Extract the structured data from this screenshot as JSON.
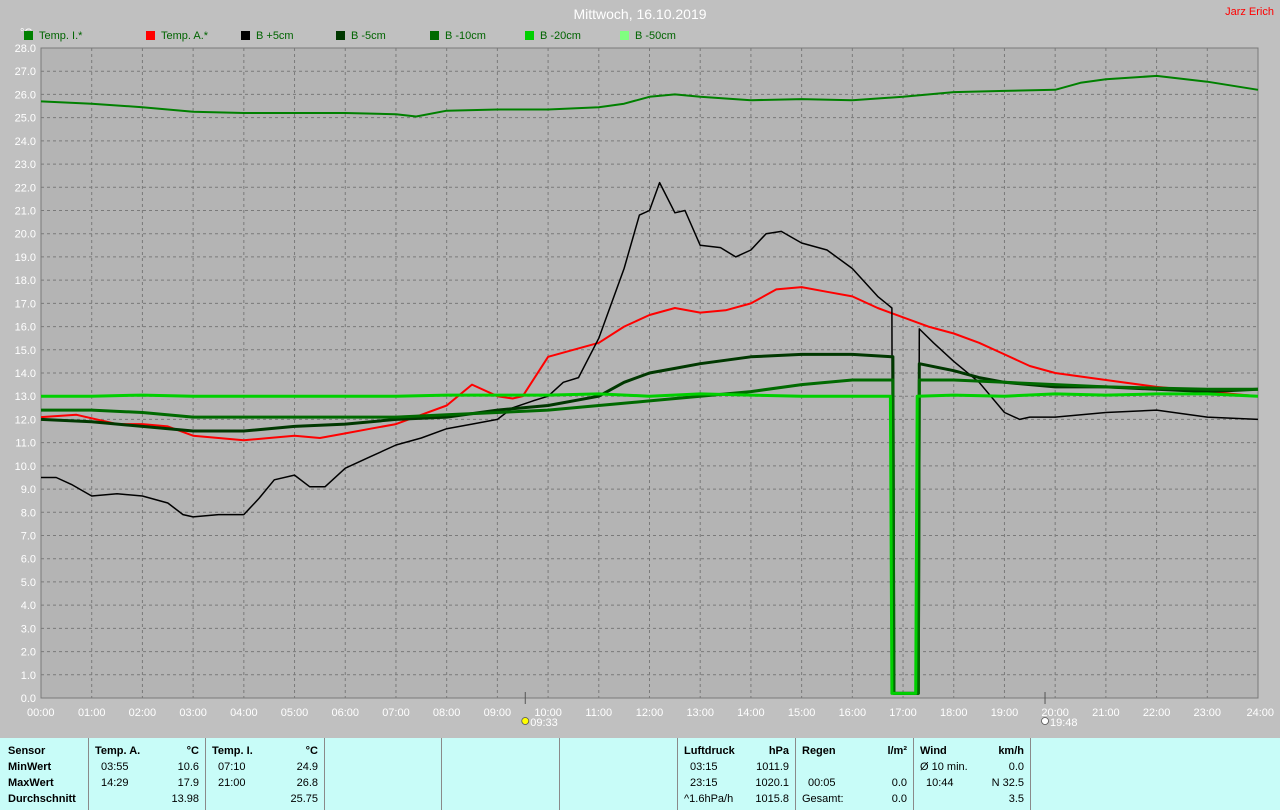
{
  "header": {
    "title": "Mittwoch, 16.10.2019",
    "author": "Jarz Erich"
  },
  "chart_data": {
    "type": "line",
    "ylabel": "°C",
    "ylim": [
      0,
      28
    ],
    "yticks": [
      "0.0",
      "1.0",
      "2.0",
      "3.0",
      "4.0",
      "5.0",
      "6.0",
      "7.0",
      "8.0",
      "9.0",
      "10.0",
      "11.0",
      "12.0",
      "13.0",
      "14.0",
      "15.0",
      "16.0",
      "17.0",
      "18.0",
      "19.0",
      "20.0",
      "21.0",
      "22.0",
      "23.0",
      "24.0",
      "25.0",
      "26.0",
      "27.0",
      "28.0"
    ],
    "xlim": [
      0,
      24
    ],
    "xticks": [
      "00:00",
      "01:00",
      "02:00",
      "03:00",
      "04:00",
      "05:00",
      "06:00",
      "07:00",
      "08:00",
      "09:00",
      "10:00",
      "11:00",
      "12:00",
      "13:00",
      "14:00",
      "15:00",
      "16:00",
      "17:00",
      "18:00",
      "19:00",
      "20:00",
      "21:00",
      "22:00",
      "23:00",
      "24:00"
    ],
    "grid": true,
    "legend_position": "top-left",
    "markers": [
      {
        "x": 9.55,
        "label": "09:33"
      },
      {
        "x": 19.8,
        "label": "19:48"
      }
    ],
    "series": [
      {
        "name": "Temp. I.*",
        "color": "#008000",
        "width": 2,
        "points": [
          [
            0,
            25.7
          ],
          [
            1,
            25.6
          ],
          [
            2,
            25.45
          ],
          [
            3,
            25.25
          ],
          [
            4,
            25.2
          ],
          [
            5,
            25.2
          ],
          [
            6,
            25.2
          ],
          [
            7,
            25.15
          ],
          [
            7.4,
            25.05
          ],
          [
            8,
            25.3
          ],
          [
            9,
            25.35
          ],
          [
            10,
            25.35
          ],
          [
            11,
            25.45
          ],
          [
            11.5,
            25.6
          ],
          [
            12,
            25.9
          ],
          [
            12.5,
            26.0
          ],
          [
            13,
            25.9
          ],
          [
            14,
            25.75
          ],
          [
            15,
            25.8
          ],
          [
            16,
            25.75
          ],
          [
            17,
            25.9
          ],
          [
            18,
            26.1
          ],
          [
            19,
            26.15
          ],
          [
            20,
            26.2
          ],
          [
            20.5,
            26.5
          ],
          [
            21,
            26.65
          ],
          [
            22,
            26.8
          ],
          [
            23,
            26.55
          ],
          [
            24,
            26.2
          ]
        ]
      },
      {
        "name": "Temp. A.*",
        "color": "#ff0000",
        "width": 2,
        "points": [
          [
            0,
            12.1
          ],
          [
            0.7,
            12.2
          ],
          [
            1.5,
            11.8
          ],
          [
            2,
            11.8
          ],
          [
            2.5,
            11.7
          ],
          [
            3,
            11.3
          ],
          [
            3.5,
            11.2
          ],
          [
            4,
            11.1
          ],
          [
            4.5,
            11.2
          ],
          [
            5,
            11.3
          ],
          [
            5.5,
            11.2
          ],
          [
            6,
            11.4
          ],
          [
            6.5,
            11.6
          ],
          [
            7,
            11.8
          ],
          [
            7.5,
            12.2
          ],
          [
            8,
            12.6
          ],
          [
            8.5,
            13.5
          ],
          [
            9,
            13.0
          ],
          [
            9.3,
            12.9
          ],
          [
            9.5,
            13.0
          ],
          [
            10,
            14.7
          ],
          [
            10.5,
            15.0
          ],
          [
            11,
            15.3
          ],
          [
            11.5,
            16.0
          ],
          [
            12,
            16.5
          ],
          [
            12.5,
            16.8
          ],
          [
            13,
            16.6
          ],
          [
            13.5,
            16.7
          ],
          [
            14,
            17.0
          ],
          [
            14.5,
            17.6
          ],
          [
            15,
            17.7
          ],
          [
            15.5,
            17.5
          ],
          [
            16,
            17.3
          ],
          [
            16.5,
            16.8
          ],
          [
            17,
            16.4
          ],
          [
            17.5,
            16.0
          ],
          [
            18,
            15.7
          ],
          [
            18.5,
            15.3
          ],
          [
            19,
            14.8
          ],
          [
            19.5,
            14.3
          ],
          [
            20,
            14.0
          ],
          [
            21,
            13.7
          ],
          [
            22,
            13.4
          ],
          [
            23,
            13.2
          ],
          [
            24,
            13.0
          ]
        ]
      },
      {
        "name": "B +5cm",
        "color": "#000000",
        "width": 1.5,
        "points": [
          [
            0,
            9.5
          ],
          [
            0.3,
            9.5
          ],
          [
            0.6,
            9.2
          ],
          [
            1,
            8.7
          ],
          [
            1.5,
            8.8
          ],
          [
            2,
            8.7
          ],
          [
            2.5,
            8.4
          ],
          [
            2.8,
            7.9
          ],
          [
            3,
            7.8
          ],
          [
            3.5,
            7.9
          ],
          [
            4,
            7.9
          ],
          [
            4.3,
            8.6
          ],
          [
            4.6,
            9.4
          ],
          [
            5,
            9.6
          ],
          [
            5.3,
            9.1
          ],
          [
            5.6,
            9.1
          ],
          [
            6,
            9.9
          ],
          [
            6.5,
            10.4
          ],
          [
            7,
            10.9
          ],
          [
            7.5,
            11.2
          ],
          [
            8,
            11.6
          ],
          [
            8.5,
            11.8
          ],
          [
            9,
            12.0
          ],
          [
            9.3,
            12.5
          ],
          [
            9.7,
            12.8
          ],
          [
            10,
            13.0
          ],
          [
            10.3,
            13.6
          ],
          [
            10.6,
            13.8
          ],
          [
            11,
            15.5
          ],
          [
            11.5,
            18.5
          ],
          [
            11.8,
            20.8
          ],
          [
            12,
            21.0
          ],
          [
            12.2,
            22.2
          ],
          [
            12.5,
            20.9
          ],
          [
            12.7,
            21.0
          ],
          [
            13,
            19.5
          ],
          [
            13.4,
            19.4
          ],
          [
            13.7,
            19.0
          ],
          [
            14,
            19.3
          ],
          [
            14.3,
            20.0
          ],
          [
            14.6,
            20.1
          ],
          [
            15,
            19.6
          ],
          [
            15.5,
            19.3
          ],
          [
            16,
            18.5
          ],
          [
            16.5,
            17.3
          ],
          [
            16.78,
            16.8
          ],
          [
            16.8,
            0.2
          ],
          [
            17.3,
            0.2
          ],
          [
            17.32,
            15.9
          ],
          [
            17.6,
            15.3
          ],
          [
            18,
            14.5
          ],
          [
            18.5,
            13.6
          ],
          [
            19,
            12.3
          ],
          [
            19.3,
            12.0
          ],
          [
            19.5,
            12.1
          ],
          [
            20,
            12.1
          ],
          [
            21,
            12.3
          ],
          [
            22,
            12.4
          ],
          [
            23,
            12.1
          ],
          [
            24,
            12.0
          ]
        ]
      },
      {
        "name": "B -5cm",
        "color": "#003800",
        "width": 3,
        "points": [
          [
            0,
            12.0
          ],
          [
            1,
            11.9
          ],
          [
            2,
            11.7
          ],
          [
            3,
            11.5
          ],
          [
            4,
            11.5
          ],
          [
            5,
            11.7
          ],
          [
            6,
            11.8
          ],
          [
            7,
            12.0
          ],
          [
            8,
            12.1
          ],
          [
            9,
            12.4
          ],
          [
            10,
            12.6
          ],
          [
            11,
            13.0
          ],
          [
            11.5,
            13.6
          ],
          [
            12,
            14.0
          ],
          [
            12.5,
            14.2
          ],
          [
            13,
            14.4
          ],
          [
            14,
            14.7
          ],
          [
            15,
            14.8
          ],
          [
            16,
            14.8
          ],
          [
            16.8,
            14.7
          ],
          [
            16.82,
            0.2
          ],
          [
            17.3,
            0.2
          ],
          [
            17.32,
            14.4
          ],
          [
            18,
            14.1
          ],
          [
            18.5,
            13.8
          ],
          [
            19,
            13.6
          ],
          [
            20,
            13.4
          ],
          [
            21,
            13.4
          ],
          [
            22,
            13.3
          ],
          [
            23,
            13.2
          ],
          [
            24,
            13.3
          ]
        ]
      },
      {
        "name": "B -10cm",
        "color": "#006a00",
        "width": 3,
        "points": [
          [
            0,
            12.4
          ],
          [
            1,
            12.4
          ],
          [
            2,
            12.3
          ],
          [
            3,
            12.1
          ],
          [
            4,
            12.1
          ],
          [
            5,
            12.1
          ],
          [
            6,
            12.1
          ],
          [
            7,
            12.1
          ],
          [
            8,
            12.2
          ],
          [
            9,
            12.3
          ],
          [
            10,
            12.4
          ],
          [
            11,
            12.6
          ],
          [
            12,
            12.8
          ],
          [
            13,
            13.0
          ],
          [
            14,
            13.2
          ],
          [
            15,
            13.5
          ],
          [
            16,
            13.7
          ],
          [
            16.8,
            13.7
          ],
          [
            16.82,
            0.2
          ],
          [
            17.3,
            0.2
          ],
          [
            17.32,
            13.7
          ],
          [
            18,
            13.7
          ],
          [
            19,
            13.6
          ],
          [
            20,
            13.5
          ],
          [
            21,
            13.4
          ],
          [
            22,
            13.35
          ],
          [
            23,
            13.3
          ],
          [
            24,
            13.3
          ]
        ]
      },
      {
        "name": "B -20cm",
        "color": "#00d000",
        "width": 3,
        "points": [
          [
            0,
            13.0
          ],
          [
            1,
            13.0
          ],
          [
            2,
            13.05
          ],
          [
            3,
            13.0
          ],
          [
            4,
            13.0
          ],
          [
            5,
            13.0
          ],
          [
            6,
            13.0
          ],
          [
            7,
            13.0
          ],
          [
            8,
            13.05
          ],
          [
            9,
            13.05
          ],
          [
            10,
            13.05
          ],
          [
            11,
            13.1
          ],
          [
            12,
            13.0
          ],
          [
            13,
            13.1
          ],
          [
            14,
            13.05
          ],
          [
            15,
            13.0
          ],
          [
            16,
            13.0
          ],
          [
            16.75,
            13.0
          ],
          [
            16.78,
            0.2
          ],
          [
            17.25,
            0.2
          ],
          [
            17.28,
            13.0
          ],
          [
            18,
            13.05
          ],
          [
            19,
            13.0
          ],
          [
            20,
            13.1
          ],
          [
            21,
            13.05
          ],
          [
            22,
            13.1
          ],
          [
            23,
            13.1
          ],
          [
            24,
            13.0
          ]
        ]
      },
      {
        "name": "B -50cm",
        "color": "#80ff80",
        "width": 1,
        "points": []
      }
    ]
  },
  "stats": {
    "sensor": {
      "header": "Sensor",
      "rows": [
        "MinWert",
        "MaxWert",
        "Durchschnitt"
      ]
    },
    "temp_a": {
      "header": "Temp. A.",
      "unit": "°C",
      "min_time": "03:55",
      "min_value": "10.6",
      "max_time": "14:29",
      "max_value": "17.9",
      "avg_value": "13.98"
    },
    "temp_i": {
      "header": "Temp. I.",
      "unit": "°C",
      "min_time": "07:10",
      "min_value": "24.9",
      "max_time": "21:00",
      "max_value": "26.8",
      "avg_value": "25.75"
    },
    "pressure": {
      "header": "Luftdruck",
      "unit": "hPa",
      "min_time": "03:15",
      "min_value": "1011.9",
      "max_time": "23:15",
      "max_value": "1020.1",
      "trend_label": "^1.6hPa/h",
      "trend_value": "1015.8"
    },
    "rain": {
      "header": "Regen",
      "unit": "l/m²",
      "time": "00:05",
      "value": "0.0",
      "total_label": "Gesamt:",
      "total_value": "0.0"
    },
    "wind": {
      "header": "Wind",
      "unit": "km/h",
      "avg_label": "Ø 10 min.",
      "avg_value": "0.0",
      "max_time": "10:44",
      "max_value": "N 32.5",
      "value3": "3.5"
    }
  }
}
